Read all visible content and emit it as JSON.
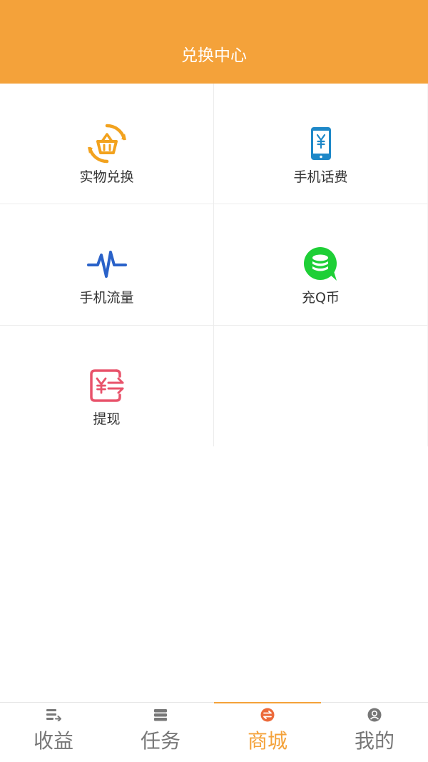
{
  "header": {
    "title": "兑换中心"
  },
  "colors": {
    "brand": "#F4A23A",
    "physical": "#F2A21E",
    "phone": "#1E88C8",
    "data": "#2A62C9",
    "qcoin": "#1ECF36",
    "withdraw": "#E8536B",
    "tab_inactive": "#777777",
    "tab_active": "#F4A23A"
  },
  "grid": {
    "items": [
      {
        "label": "实物兑换",
        "icon": "basket-exchange-icon"
      },
      {
        "label": "手机话费",
        "icon": "phone-yuan-icon"
      },
      {
        "label": "手机流量",
        "icon": "pulse-wave-icon"
      },
      {
        "label": "充Q币",
        "icon": "coin-chat-icon"
      },
      {
        "label": "提现",
        "icon": "withdraw-yuan-icon"
      }
    ]
  },
  "tabbar": {
    "tabs": [
      {
        "label": "收益",
        "icon": "earnings-icon",
        "active": false
      },
      {
        "label": "任务",
        "icon": "tasks-icon",
        "active": false
      },
      {
        "label": "商城",
        "icon": "exchange-icon",
        "active": true
      },
      {
        "label": "我的",
        "icon": "profile-icon",
        "active": false
      }
    ]
  }
}
